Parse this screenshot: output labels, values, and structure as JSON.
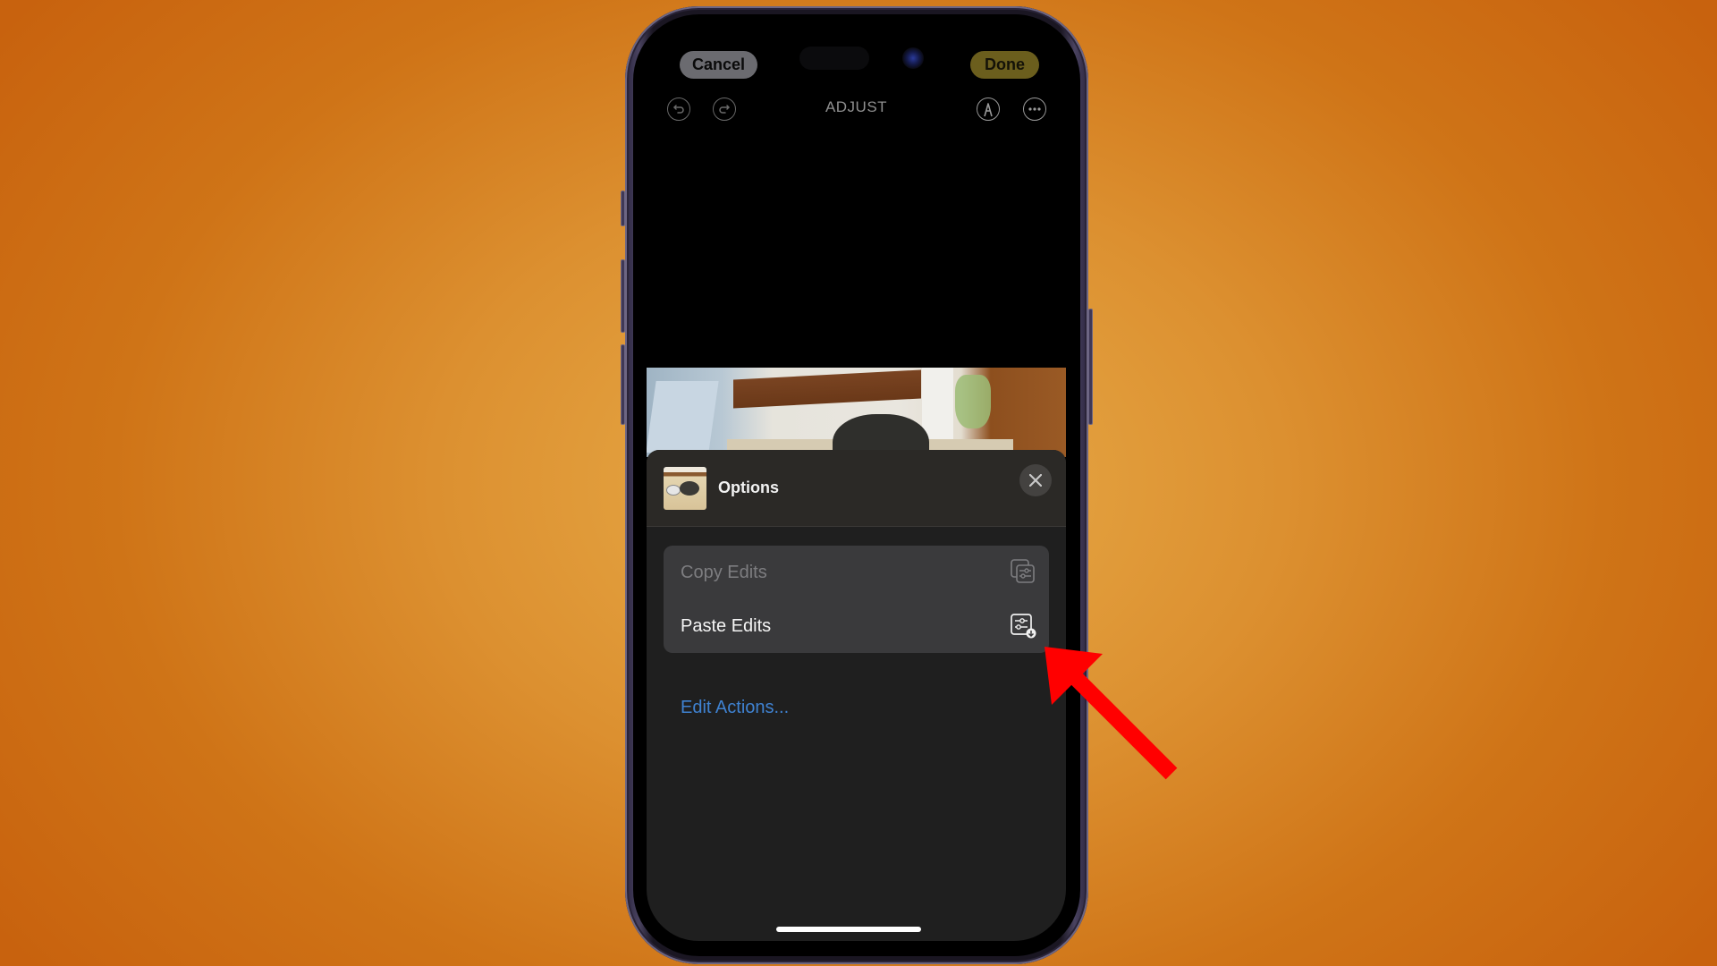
{
  "top_bar": {
    "cancel_label": "Cancel",
    "done_label": "Done",
    "done_color": "#6b5e1d",
    "mode_title": "ADJUST",
    "icons": [
      "undo-icon",
      "redo-icon",
      "markup-icon",
      "more-icon"
    ]
  },
  "photo": {
    "description": "Dog eating from bowl near wooden stairs"
  },
  "options_sheet": {
    "title": "Options",
    "close_icon": "close-icon",
    "menu_items": [
      {
        "label": "Copy Edits",
        "icon": "copy-edits-icon",
        "enabled": false
      },
      {
        "label": "Paste Edits",
        "icon": "paste-edits-icon",
        "enabled": true
      }
    ],
    "edit_actions_label": "Edit Actions...",
    "link_color": "#3f82d1"
  },
  "annotation": {
    "arrow_color": "#ff0000",
    "points_to": "Paste Edits"
  }
}
